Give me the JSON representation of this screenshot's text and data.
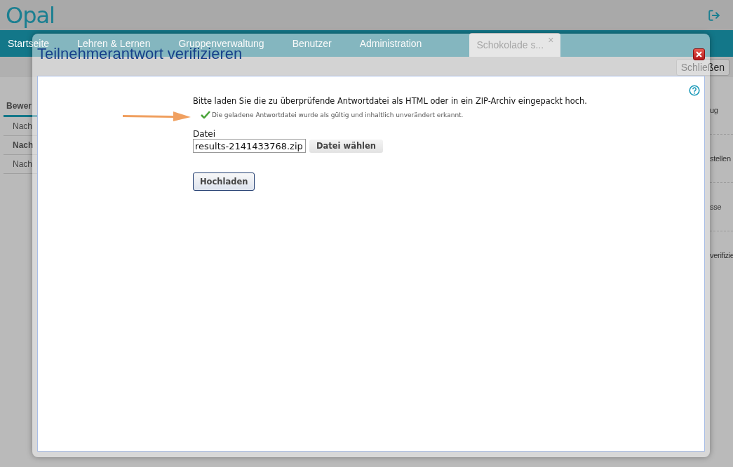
{
  "header": {
    "logo": "Opal"
  },
  "nav": {
    "items": [
      {
        "label": "Startseite",
        "selected": false
      },
      {
        "label": "Lehren & Lernen",
        "selected": false
      },
      {
        "label": "Gruppenverwaltung",
        "selected": false
      },
      {
        "label": "Benutzer",
        "selected": false
      },
      {
        "label": "Administration",
        "selected": false
      },
      {
        "label": "Schokolade s...",
        "selected": true,
        "close": "×"
      }
    ]
  },
  "toolbar": {
    "close_button": "Schließen"
  },
  "sidebar": {
    "tab": "Bewer",
    "items": [
      {
        "label": "Nach",
        "selected": false
      },
      {
        "label": "Nach",
        "selected": true
      },
      {
        "label": "Nach",
        "selected": false
      }
    ]
  },
  "right_column": [
    {
      "text": "ug",
      "divider": true
    },
    {
      "text": "stellen",
      "divider": true
    },
    {
      "text": "sse",
      "divider": true
    },
    {
      "text": "verifizie",
      "divider": false
    }
  ],
  "dialog": {
    "title": "Teilnehmerantwort verifizieren",
    "instruction": "Bitte laden Sie die zu überprüfende Antwortdatei als HTML oder in ein ZIP-Archiv eingepackt hoch.",
    "success_message": "Die geladene Antwortdatei wurde als gültig und inhaltlich unverändert erkannt.",
    "file_label": "Datei",
    "file_value": "results-2141433768.zip",
    "choose_button": "Datei wählen",
    "upload_button": "Hochladen"
  }
}
